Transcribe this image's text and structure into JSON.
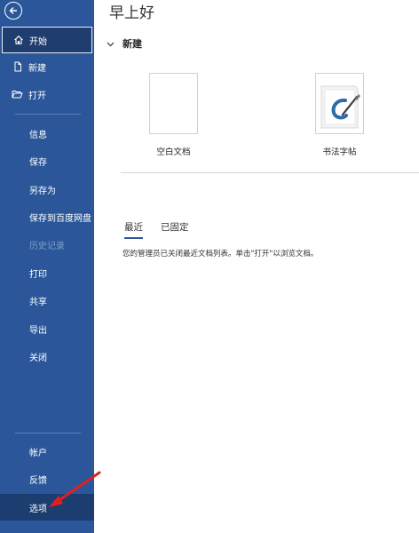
{
  "header": {
    "greeting": "早上好"
  },
  "sidebar": {
    "top_items": [
      {
        "label": "开始",
        "icon": "home-icon",
        "active": true
      },
      {
        "label": "新建",
        "icon": "new-document-icon"
      },
      {
        "label": "打开",
        "icon": "folder-open-icon"
      }
    ],
    "middle_items": [
      {
        "label": "信息"
      },
      {
        "label": "保存"
      },
      {
        "label": "另存为"
      },
      {
        "label": "保存到百度网盘"
      },
      {
        "label": "历史记录",
        "disabled": true
      },
      {
        "label": "打印"
      },
      {
        "label": "共享"
      },
      {
        "label": "导出"
      },
      {
        "label": "关闭"
      }
    ],
    "bottom_items": [
      {
        "label": "帐户"
      },
      {
        "label": "反馈"
      },
      {
        "label": "选项",
        "selected": true
      }
    ]
  },
  "new_section": {
    "title": "新建",
    "templates": [
      {
        "label": "空白文档"
      },
      {
        "label": "书法字帖"
      }
    ]
  },
  "recent": {
    "tabs": [
      "最近",
      "已固定"
    ],
    "active_tab": "最近",
    "notice": "您的管理员已关闭最近文档列表。单击\"打开\"以浏览文档。"
  },
  "colors": {
    "sidebar_bg": "#2b579a",
    "annotation_arrow": "#e02020"
  }
}
